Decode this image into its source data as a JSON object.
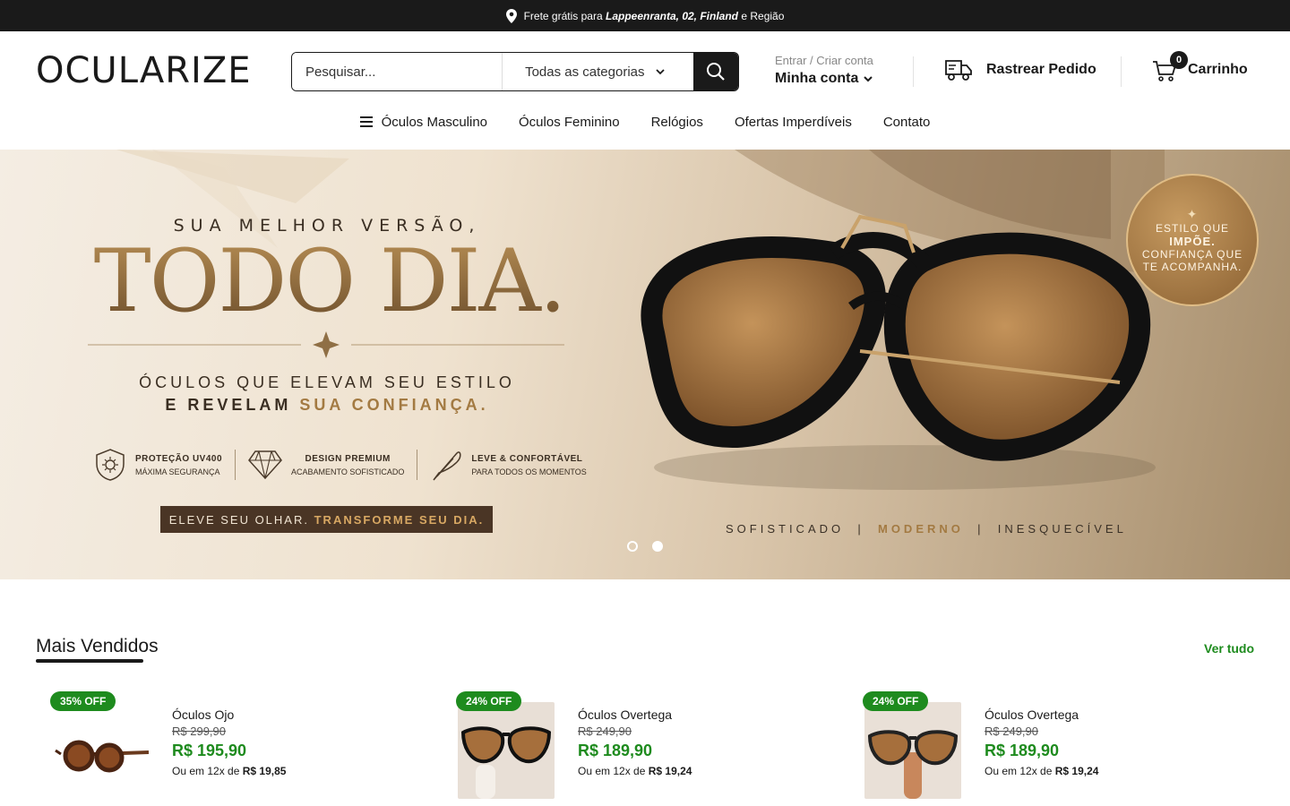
{
  "topbar": {
    "prefix": "Frete grátis para",
    "location": "Lappeenranta, 02, Finland",
    "suffix": "e Região",
    "icon": "map-pin-icon"
  },
  "header": {
    "logo": "OCULARIZE",
    "search": {
      "placeholder": "Pesquisar...",
      "category": "Todas as categorias"
    },
    "account": {
      "small": "Entrar / Criar conta",
      "big": "Minha conta"
    },
    "track_label": "Rastrear Pedido",
    "cart": {
      "label": "Carrinho",
      "count": "0"
    }
  },
  "nav": {
    "items": [
      "Óculos Masculino",
      "Óculos Feminino",
      "Relógios",
      "Ofertas Imperdíveis",
      "Contato"
    ]
  },
  "hero": {
    "kicker": "SUA MELHOR VERSÃO,",
    "headline": "TODO DIA.",
    "line1": "ÓCULOS QUE ELEVAM SEU ESTILO",
    "line2_a": "E REVELAM",
    "line2_b": "SUA CONFIANÇA.",
    "features": [
      {
        "title": "PROTEÇÃO UV400",
        "sub": "MÁXIMA SEGURANÇA"
      },
      {
        "title": "DESIGN PREMIUM",
        "sub": "ACABAMENTO SOFISTICADO"
      },
      {
        "title": "LEVE & CONFORTÁVEL",
        "sub": "PARA TODOS OS MOMENTOS"
      }
    ],
    "cta_a": "ELEVE SEU OLHAR.",
    "cta_b": "TRANSFORME SEU DIA.",
    "badge": {
      "l1": "ESTILO QUE",
      "l2": "IMPÕE.",
      "l3": "CONFIANÇA QUE",
      "l4": "TE ACOMPANHA."
    },
    "tagline": {
      "a": "SOFISTICADO",
      "sep1": "|",
      "b": "MODERNO",
      "sep2": "|",
      "c": "INESQUECÍVEL"
    },
    "slides": {
      "count": 2,
      "active": 1
    }
  },
  "bestsellers": {
    "title": "Mais Vendidos",
    "view_all": "Ver tudo",
    "products": [
      {
        "badge": "35% OFF",
        "name": "Óculos Ojo",
        "old_price": "R$ 299,90",
        "price": "R$ 195,90",
        "inst_prefix": "Ou em 12x de",
        "inst_value": "R$ 19,85"
      },
      {
        "badge": "24% OFF",
        "name": "Óculos Overtega",
        "old_price": "R$ 249,90",
        "price": "R$ 189,90",
        "inst_prefix": "Ou em 12x de",
        "inst_value": "R$ 19,24"
      },
      {
        "badge": "24% OFF",
        "name": "Óculos Overtega",
        "old_price": "R$ 249,90",
        "price": "R$ 189,90",
        "inst_prefix": "Ou em 12x de",
        "inst_value": "R$ 19,24"
      }
    ]
  },
  "colors": {
    "accent_green": "#1e8b1e",
    "dark": "#1a1a1a",
    "gold": "#a37a42"
  }
}
